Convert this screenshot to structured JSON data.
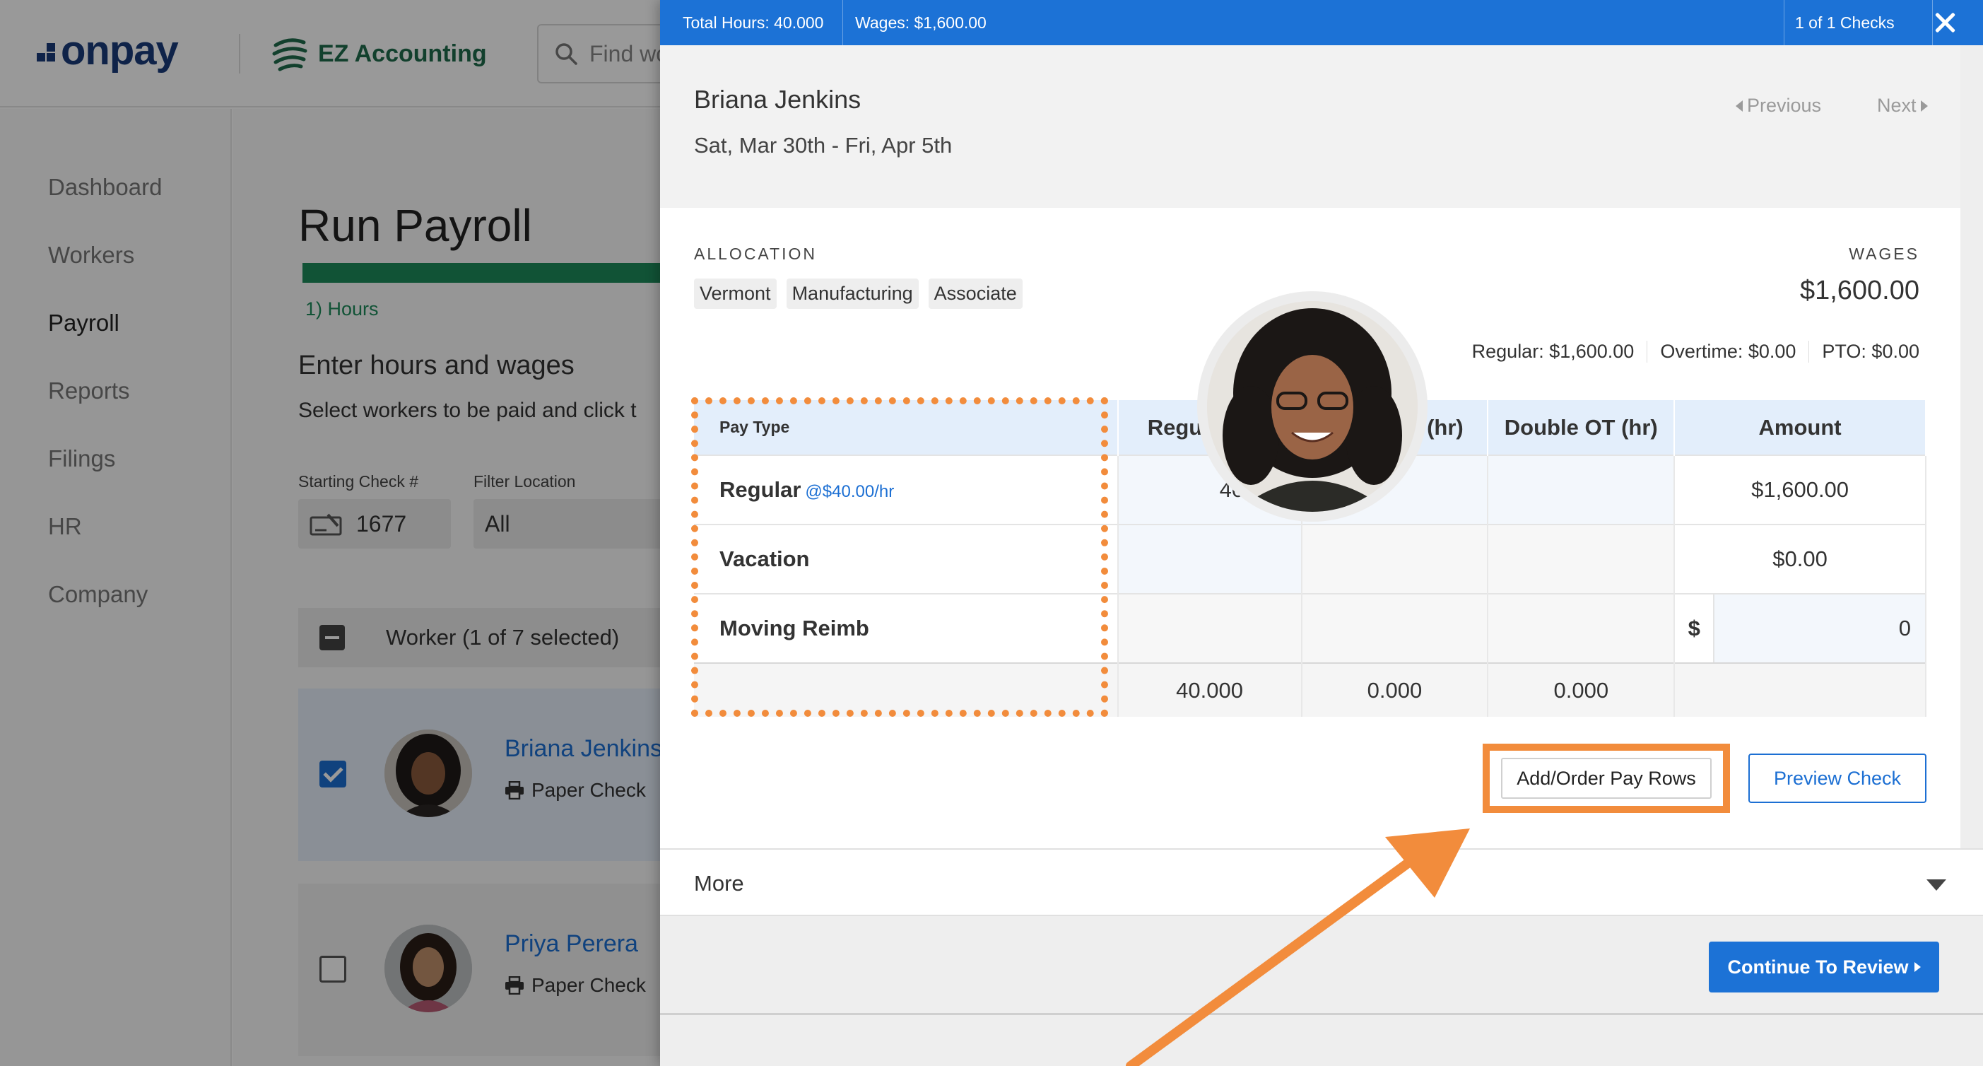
{
  "app": {
    "brand": "onpay",
    "partner": "EZ Accounting",
    "search_placeholder": "Find wo"
  },
  "sidebar": {
    "items": [
      {
        "label": "Dashboard",
        "active": false
      },
      {
        "label": "Workers",
        "active": false
      },
      {
        "label": "Payroll",
        "active": true
      },
      {
        "label": "Reports",
        "active": false
      },
      {
        "label": "Filings",
        "active": false
      },
      {
        "label": "HR",
        "active": false
      },
      {
        "label": "Company",
        "active": false
      }
    ]
  },
  "main": {
    "title": "Run Payroll",
    "step": "1) Hours",
    "section_title": "Enter hours and wages",
    "section_sub": "Select workers to be paid and click t",
    "starting_check_label": "Starting Check #",
    "starting_check_value": "1677",
    "filter_location_label": "Filter Location",
    "filter_location_value": "All",
    "worker_header": "Worker (1 of 7 selected)",
    "workers": [
      {
        "name": "Briana Jenkins",
        "method": "Paper Check",
        "selected": true
      },
      {
        "name": "Priya Perera",
        "method": "Paper Check",
        "selected": false
      }
    ]
  },
  "panel": {
    "topbar": {
      "total_hours": "Total Hours: 40.000",
      "wages": "Wages: $1,600.00",
      "check_count": "1 of 1 Checks"
    },
    "employee_name": "Briana Jenkins",
    "period": "Sat, Mar 30th - Fri, Apr 5th",
    "prev_label": "Previous",
    "next_label": "Next",
    "allocation_label": "ALLOCATION",
    "allocation_chips": [
      "Vermont",
      "Manufacturing",
      "Associate"
    ],
    "wages_label": "WAGES",
    "wages_value": "$1,600.00",
    "breakdown": {
      "regular": "Regular: $1,600.00",
      "overtime": "Overtime: $0.00",
      "pto": "PTO: $0.00"
    },
    "table": {
      "headers": {
        "pay_type": "Pay Type",
        "regular": "Regular (hr)",
        "overtime": "Overtime (hr)",
        "double_ot": "Double OT (hr)",
        "amount": "Amount"
      },
      "rows": [
        {
          "label": "Regular",
          "rate": "@$40.00/hr",
          "regular": "40.000",
          "overtime": "",
          "double_ot": "",
          "amount": "$1,600.00"
        },
        {
          "label": "Vacation",
          "regular": "",
          "overtime": "",
          "double_ot": "",
          "amount": "$0.00"
        },
        {
          "label": "Moving Reimb",
          "regular": "",
          "overtime": "",
          "double_ot": "",
          "amount_prefix": "$",
          "amount": "0"
        }
      ],
      "totals": {
        "regular": "40.000",
        "overtime": "0.000",
        "double_ot": "0.000"
      }
    },
    "add_rows_label": "Add/Order Pay Rows",
    "preview_label": "Preview Check",
    "more_label": "More",
    "continue_label": "Continue To Review",
    "highlight_color": "#f28c3c",
    "accent_color": "#1c72d6"
  }
}
